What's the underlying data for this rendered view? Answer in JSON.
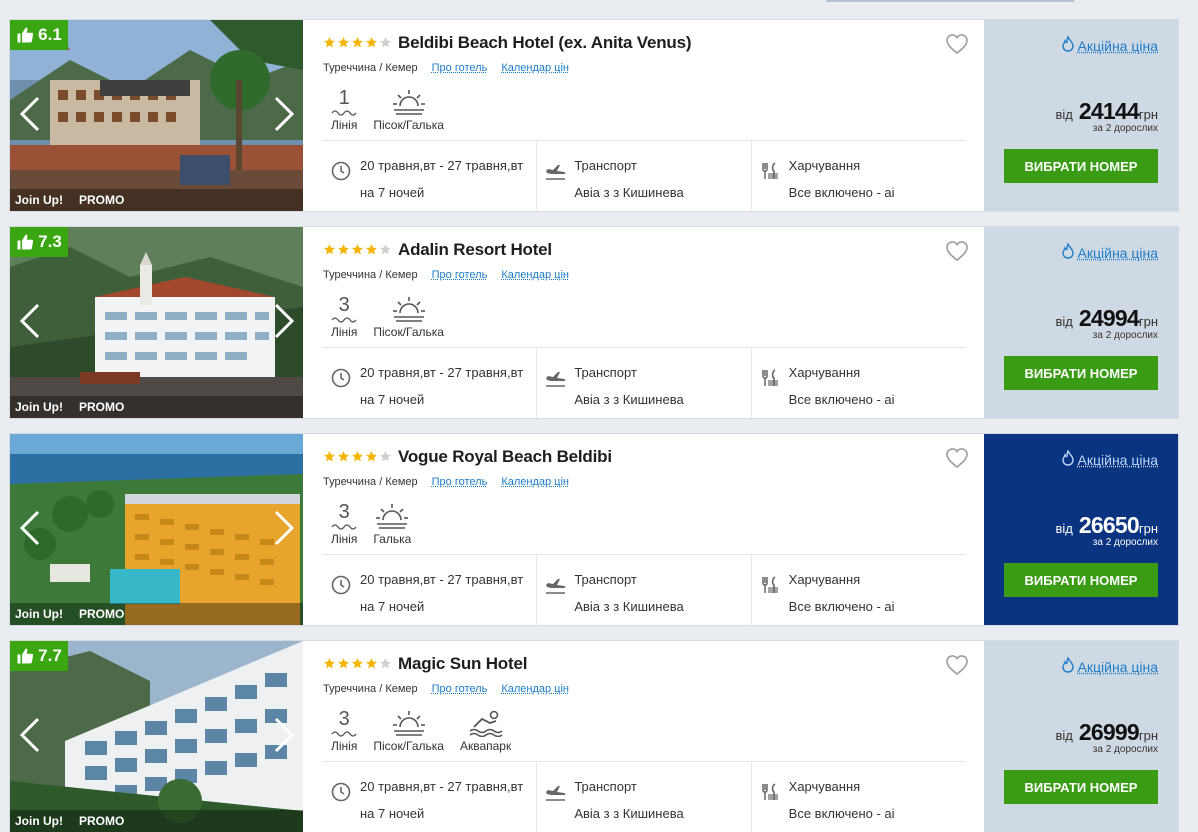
{
  "labels": {
    "from": "від",
    "currency": "грн",
    "adults": "за 2 дорослих",
    "book": "ВИБРАТИ НОМЕР",
    "promo": "Акційна ціна",
    "about_hotel": "Про готель",
    "price_calendar": "Календар цін",
    "badge_joinup": "Join Up!",
    "badge_promo": "PROMO",
    "line_label": "Лінія",
    "transport": "Транспорт",
    "food": "Харчування"
  },
  "hotels": [
    {
      "rating": "6.1",
      "stars": 4,
      "name": "Beldibi Beach Hotel (ex. Anita Venus)",
      "location": "Туреччина / Кемер",
      "line": "1",
      "beach": "Пісок/Галька",
      "extra": "",
      "dates": "20 травня,вт - 27 травня,вт",
      "nights": "на 7 ночей",
      "transport_value": "Авіа з з Кишинева",
      "food_value": "Все включено - ai",
      "price": "24144",
      "highlight": false,
      "photo_theme": "building-red"
    },
    {
      "rating": "7.3",
      "stars": 4,
      "name": "Adalin Resort Hotel",
      "location": "Туреччина / Кемер",
      "line": "3",
      "beach": "Пісок/Галька",
      "extra": "",
      "dates": "20 травня,вт - 27 травня,вт",
      "nights": "на 7 ночей",
      "transport_value": "Авіа з з Кишинева",
      "food_value": "Все включено - ai",
      "price": "24994",
      "highlight": false,
      "photo_theme": "building-white"
    },
    {
      "rating": "",
      "stars": 4,
      "name": "Vogue Royal Beach Beldibi",
      "location": "Туреччина / Кемер",
      "line": "3",
      "beach": "Галька",
      "extra": "",
      "dates": "20 травня,вт - 27 травня,вт",
      "nights": "на 7 ночей",
      "transport_value": "Авіа з з Кишинева",
      "food_value": "Все включено - ai",
      "price": "26650",
      "highlight": true,
      "photo_theme": "building-orange"
    },
    {
      "rating": "7.7",
      "stars": 4,
      "name": "Magic Sun Hotel",
      "location": "Туреччина / Кемер",
      "line": "3",
      "beach": "Пісок/Галька",
      "extra": "Аквапарк",
      "dates": "20 травня,вт - 27 травня,вт",
      "nights": "на 7 ночей",
      "transport_value": "Авіа з з Кишинева",
      "food_value": "Все включено - ai",
      "price": "26999",
      "highlight": false,
      "photo_theme": "building-balcony"
    }
  ],
  "colors": {
    "accent_green": "#3a9c14",
    "rating_green": "#3aa612",
    "link_blue": "#1d7cc7",
    "price_bg": "#cfd9e4",
    "price_bg_highlight": "#0a3380",
    "star_gold": "#f5b400"
  },
  "icons": [
    "thumbs-up-icon",
    "chevron-left-icon",
    "chevron-right-icon",
    "star-icon",
    "heart-icon",
    "wave-icon",
    "sunset-icon",
    "swimmer-icon",
    "clock-icon",
    "plane-icon",
    "fork-knife-icon",
    "flame-icon"
  ]
}
